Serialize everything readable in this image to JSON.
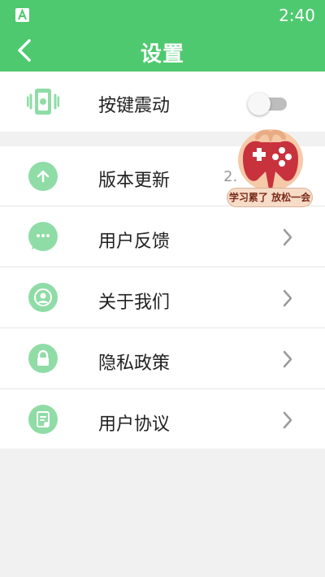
{
  "status_bar": {
    "time": "2:40",
    "app_icon": "app-a-icon"
  },
  "header": {
    "title": "设置",
    "back_icon": "back-arrow-icon"
  },
  "settings": {
    "vibration": {
      "label": "按键震动",
      "icon": "phone-vibrate-icon",
      "enabled": false
    },
    "items": [
      {
        "label": "版本更新",
        "icon": "upload-arrow-icon",
        "value": "2."
      },
      {
        "label": "用户反馈",
        "icon": "chat-bubble-icon"
      },
      {
        "label": "关于我们",
        "icon": "user-profile-icon"
      },
      {
        "label": "隐私政策",
        "icon": "lock-icon"
      },
      {
        "label": "用户协议",
        "icon": "document-icon"
      }
    ]
  },
  "floating_ad": {
    "label": "学习累了 放松一会",
    "icon": "game-controller-icon"
  },
  "colors": {
    "accent": "#4ec96f",
    "icon_bg": "#8fdca6",
    "page_bg": "#f1f1f1"
  }
}
